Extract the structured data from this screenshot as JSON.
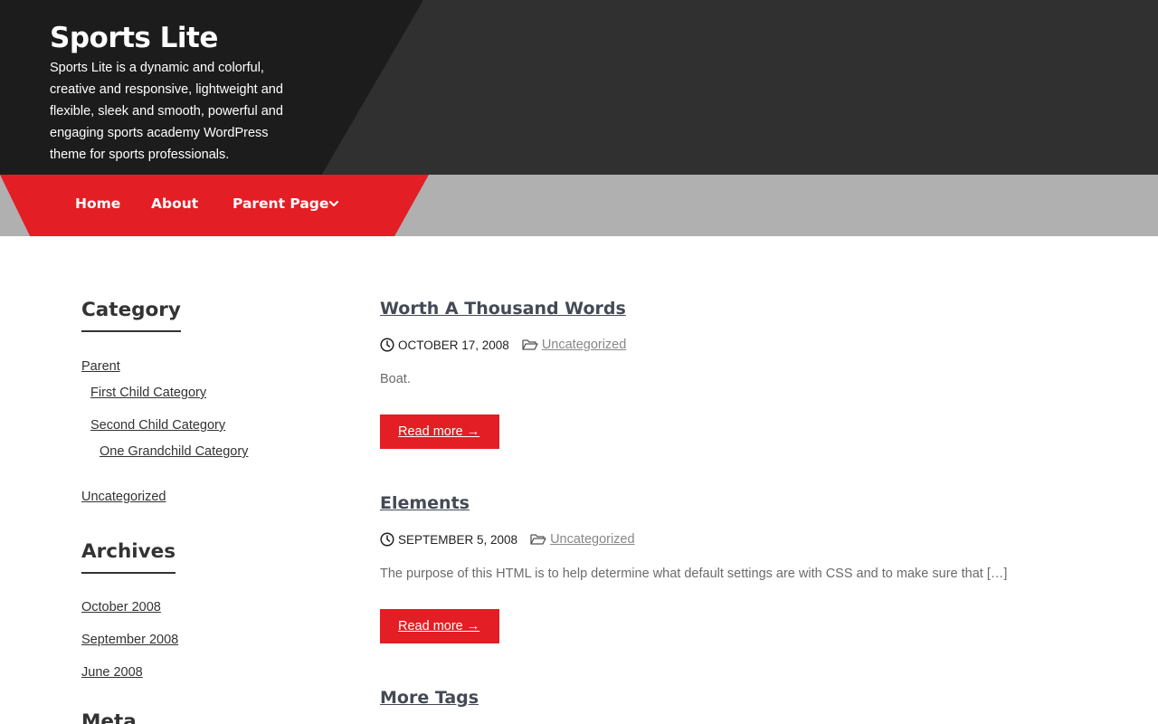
{
  "site": {
    "title": "Sports Lite",
    "description": "Sports Lite is a dynamic and colorful, creative and responsive, lightweight and flexible, sleek and smooth, powerful and engaging sports academy WordPress theme for sports professionals."
  },
  "nav": {
    "items": [
      {
        "label": "Home"
      },
      {
        "label": "About"
      },
      {
        "label": "Parent Page",
        "icon": "chevron-down-icon"
      }
    ]
  },
  "sidebar": {
    "category": {
      "title": "Category",
      "items": [
        {
          "label": "Parent"
        },
        {
          "label": "First Child Category"
        },
        {
          "label": "Second Child Category"
        },
        {
          "label": "One Grandchild Category"
        },
        {
          "label": "Uncategorized"
        }
      ]
    },
    "archives": {
      "title": "Archives",
      "items": [
        {
          "label": "October 2008"
        },
        {
          "label": "September 2008"
        },
        {
          "label": "June 2008"
        }
      ]
    },
    "meta": {
      "title": "Meta"
    }
  },
  "posts": [
    {
      "title": "Worth A Thousand Words",
      "date": "October 17, 2008",
      "category": "Uncategorized",
      "excerpt": "Boat.",
      "read_more": "Read more →"
    },
    {
      "title": "Elements",
      "date": "September 5, 2008",
      "category": "Uncategorized",
      "excerpt": "The purpose of this HTML is to help determine what default settings are with CSS and to make sure that […]",
      "read_more": "Read more →"
    },
    {
      "title": "More Tags"
    }
  ],
  "colors": {
    "accent": "#e31e24",
    "header_dark": "#1c1c1c",
    "header_bg": "#303030",
    "nav_gray": "#b0b0b0"
  }
}
